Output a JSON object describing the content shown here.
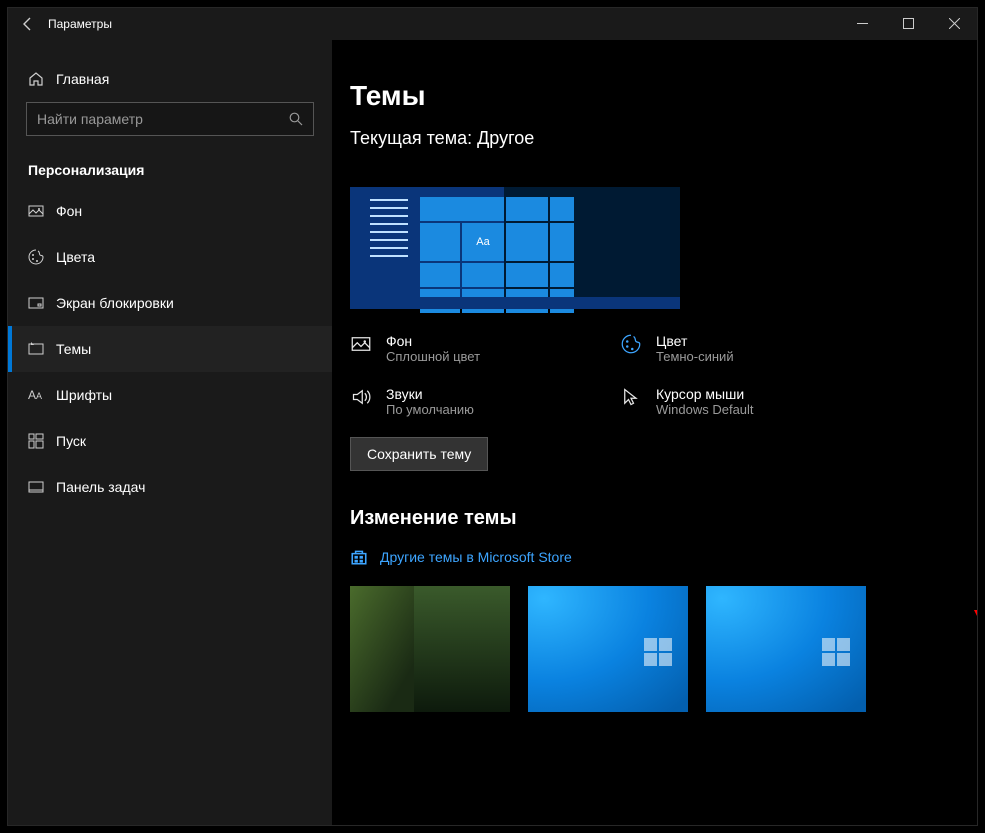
{
  "window": {
    "title": "Параметры"
  },
  "sidebar": {
    "home": "Главная",
    "search_placeholder": "Найти параметр",
    "section": "Персонализация",
    "items": [
      {
        "label": "Фон"
      },
      {
        "label": "Цвета"
      },
      {
        "label": "Экран блокировки"
      },
      {
        "label": "Темы"
      },
      {
        "label": "Шрифты"
      },
      {
        "label": "Пуск"
      },
      {
        "label": "Панель задач"
      }
    ]
  },
  "page": {
    "title": "Темы",
    "current_theme_prefix": "Текущая тема: ",
    "current_theme_value": "Другое",
    "preview_aa": "Aa",
    "props": {
      "background": {
        "title": "Фон",
        "value": "Сплошной цвет"
      },
      "color": {
        "title": "Цвет",
        "value": "Темно-синий"
      },
      "sounds": {
        "title": "Звуки",
        "value": "По умолчанию"
      },
      "cursor": {
        "title": "Курсор мыши",
        "value": "Windows Default"
      }
    },
    "save_button": "Сохранить тему",
    "change_section": "Изменение темы",
    "store_link": "Другие темы в Microsoft Store"
  }
}
